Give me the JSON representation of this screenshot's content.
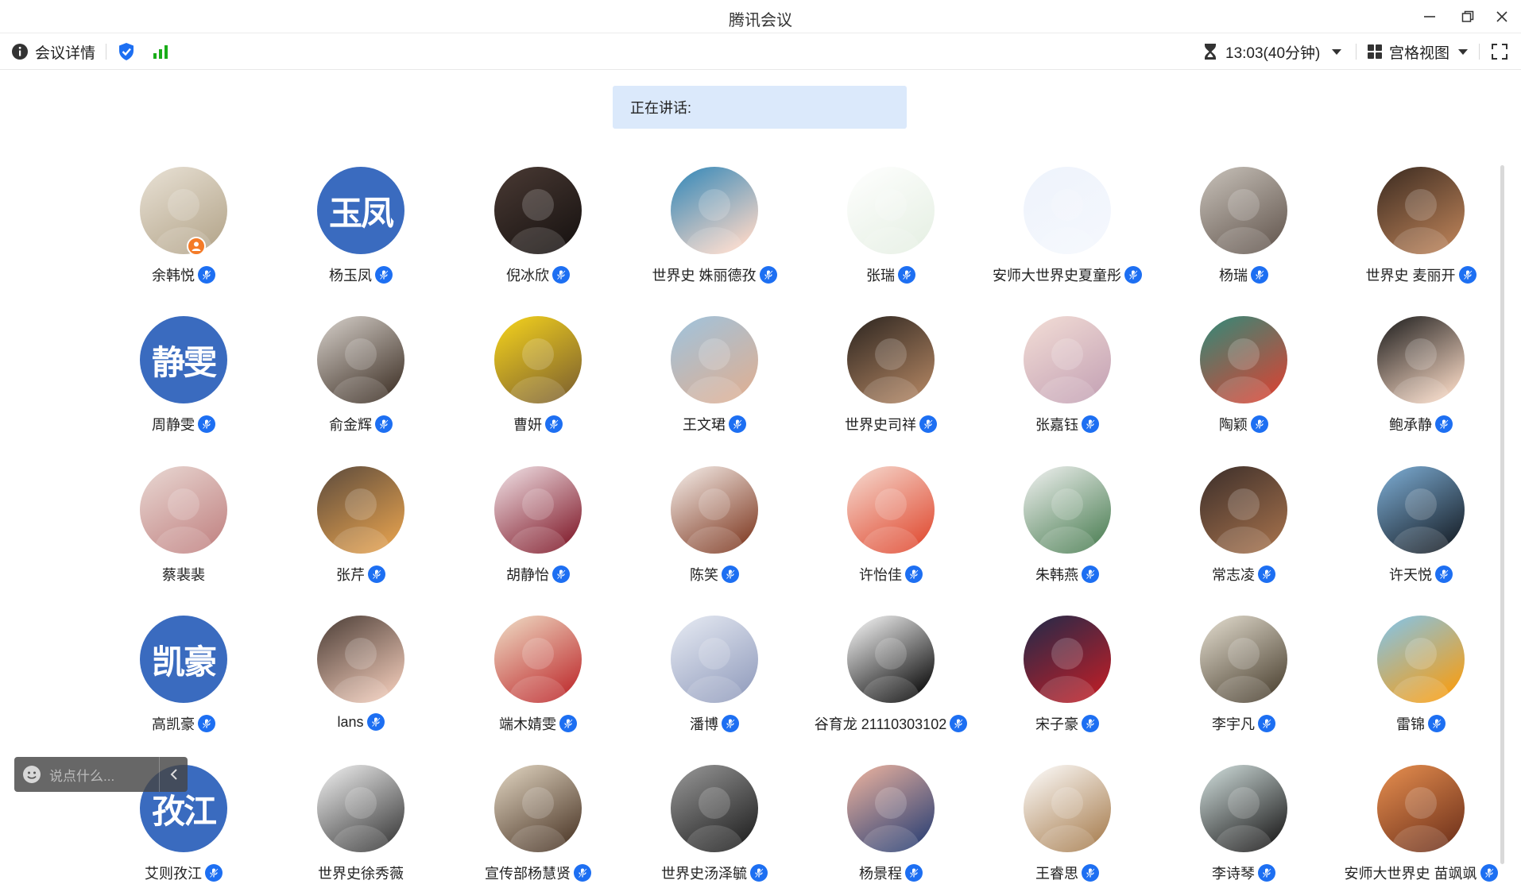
{
  "window": {
    "title": "腾讯会议"
  },
  "toolbar": {
    "details_label": "会议详情",
    "timer": "13:03(40分钟)",
    "view_label": "宫格视图"
  },
  "speaking": {
    "label": "正在讲话:"
  },
  "chat": {
    "placeholder": "说点什么..."
  },
  "colors": {
    "accent": "#1d6ff2",
    "text_avatar": "#3a6bbf",
    "speaking_bg": "#dbe9fb",
    "signal": "#1aad19",
    "host_badge": "#f47b28"
  },
  "participants": [
    {
      "name": "余韩悦",
      "avatar": "photo",
      "colors": [
        "#e9e2d6",
        "#b9ab92"
      ],
      "host": true,
      "mic": true
    },
    {
      "name": "杨玉凤",
      "avatar": "text",
      "initials": "玉凤",
      "mic": true
    },
    {
      "name": "倪冰欣",
      "avatar": "photo",
      "colors": [
        "#4a3a34",
        "#1c1614"
      ],
      "mic": true
    },
    {
      "name": "世界史 姝丽德孜",
      "avatar": "photo",
      "colors": [
        "#2f86b8",
        "#f0d3c6"
      ],
      "mic": true
    },
    {
      "name": "张瑞",
      "avatar": "photo",
      "colors": [
        "#ffffff",
        "#e8f1e6"
      ],
      "mic": true
    },
    {
      "name": "安师大世界史夏童彤",
      "avatar": "photo",
      "colors": [
        "#eef3fc",
        "#f4f7fd"
      ],
      "mic": true
    },
    {
      "name": "杨瑞",
      "avatar": "photo",
      "colors": [
        "#c9c3bb",
        "#6e625a"
      ],
      "mic": true
    },
    {
      "name": "世界史 麦丽开",
      "avatar": "photo",
      "colors": [
        "#3a2a20",
        "#b07a53"
      ],
      "mic": true
    },
    {
      "name": "周静雯",
      "avatar": "text",
      "initials": "静雯",
      "mic": true
    },
    {
      "name": "俞金辉",
      "avatar": "photo",
      "colors": [
        "#d8d2cc",
        "#4d4036"
      ],
      "mic": true
    },
    {
      "name": "曹妍",
      "avatar": "photo",
      "colors": [
        "#f7d51c",
        "#8a6d2d"
      ],
      "mic": true
    },
    {
      "name": "王文珺",
      "avatar": "photo",
      "colors": [
        "#9ec3de",
        "#d8b19a"
      ],
      "mic": true
    },
    {
      "name": "世界史司祥",
      "avatar": "photo",
      "colors": [
        "#2b241f",
        "#a57c5c"
      ],
      "mic": true
    },
    {
      "name": "张嘉钰",
      "avatar": "photo",
      "colors": [
        "#f3ded6",
        "#c9a8b8"
      ],
      "mic": true
    },
    {
      "name": "陶颖",
      "avatar": "photo",
      "colors": [
        "#2f8b7a",
        "#c94a3a"
      ],
      "mic": true
    },
    {
      "name": "鲍承静",
      "avatar": "photo",
      "colors": [
        "#1a1a1a",
        "#e8cbb8"
      ],
      "mic": true
    },
    {
      "name": "蔡裴裴",
      "avatar": "photo",
      "colors": [
        "#e9d9d4",
        "#c58b8a"
      ],
      "mic": false
    },
    {
      "name": "张芹",
      "avatar": "photo",
      "colors": [
        "#5b4a3c",
        "#d99a4d"
      ],
      "mic": true
    },
    {
      "name": "胡静怡",
      "avatar": "photo",
      "colors": [
        "#f3e6ea",
        "#8a2b3a"
      ],
      "mic": true
    },
    {
      "name": "陈笑",
      "avatar": "photo",
      "colors": [
        "#f8f2ee",
        "#8a4a34"
      ],
      "mic": true
    },
    {
      "name": "许怡佳",
      "avatar": "photo",
      "colors": [
        "#f6ddd3",
        "#e2573f"
      ],
      "mic": true
    },
    {
      "name": "朱韩燕",
      "avatar": "photo",
      "colors": [
        "#f3f3f3",
        "#5c8a63"
      ],
      "mic": true
    },
    {
      "name": "常志凌",
      "avatar": "photo",
      "colors": [
        "#3b2e2a",
        "#9a6a48"
      ],
      "mic": true
    },
    {
      "name": "许天悦",
      "avatar": "photo",
      "colors": [
        "#7fb0d8",
        "#1f2a35"
      ],
      "mic": true
    },
    {
      "name": "高凯豪",
      "avatar": "text",
      "initials": "凯豪",
      "mic": true
    },
    {
      "name": "lans",
      "avatar": "photo",
      "colors": [
        "#4a3c35",
        "#e3bfae"
      ],
      "mic": true
    },
    {
      "name": "端木婧雯",
      "avatar": "photo",
      "colors": [
        "#f0e0c8",
        "#c23a3a"
      ],
      "mic": true
    },
    {
      "name": "潘博",
      "avatar": "photo",
      "colors": [
        "#e8ecf4",
        "#9aa4c2"
      ],
      "mic": true
    },
    {
      "name": "谷育龙 21110303102",
      "avatar": "photo",
      "colors": [
        "#ffffff",
        "#1a1a1a"
      ],
      "mic": true
    },
    {
      "name": "宋子豪",
      "avatar": "photo",
      "colors": [
        "#1f2a4a",
        "#b01f2a"
      ],
      "mic": true
    },
    {
      "name": "李宇凡",
      "avatar": "photo",
      "colors": [
        "#e6e0d2",
        "#5a5040"
      ],
      "mic": true
    },
    {
      "name": "雷锦",
      "avatar": "photo",
      "colors": [
        "#7fc5ef",
        "#f0a020"
      ],
      "mic": true
    },
    {
      "name": "艾则孜江",
      "avatar": "text",
      "initials": "孜江",
      "mic": true
    },
    {
      "name": "世界史徐秀薇",
      "avatar": "photo",
      "colors": [
        "#f4f4f4",
        "#4a4a4a"
      ],
      "mic": false
    },
    {
      "name": "宣传部杨慧贤",
      "avatar": "photo",
      "colors": [
        "#e4d8c4",
        "#5a4636"
      ],
      "mic": true
    },
    {
      "name": "世界史汤泽毓",
      "avatar": "photo",
      "colors": [
        "#9a9a9a",
        "#2a2a2a"
      ],
      "mic": true
    },
    {
      "name": "杨景程",
      "avatar": "photo",
      "colors": [
        "#f1b6a0",
        "#3c4a78"
      ],
      "mic": true
    },
    {
      "name": "王睿思",
      "avatar": "photo",
      "colors": [
        "#ffffff",
        "#b08a60"
      ],
      "mic": true
    },
    {
      "name": "李诗琴",
      "avatar": "photo",
      "colors": [
        "#d4e2e0",
        "#2a2a2a"
      ],
      "mic": true
    },
    {
      "name": "安师大世界史 苗飒飒",
      "avatar": "photo",
      "colors": [
        "#e89050",
        "#7a3a20"
      ],
      "mic": true
    }
  ]
}
